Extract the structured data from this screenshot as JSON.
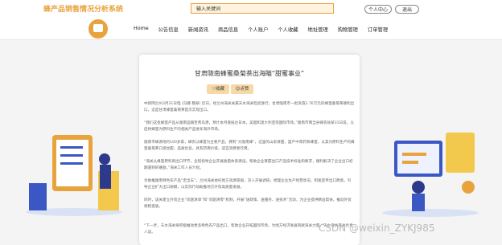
{
  "header": {
    "brand": "蜂产品销售情况分析系统",
    "search_value": "输入关键词",
    "personal_center": "个人中心",
    "logout": "退出"
  },
  "nav": {
    "items": [
      "Home",
      "公告信息",
      "新闻资讯",
      "商品信息",
      "个人账户",
      "个人收藏",
      "地址管理",
      "购物管理",
      "订单管理"
    ]
  },
  "article": {
    "title": "甘肃陇南蜂蜜桑菊茶出海瞄“甜蜜事业”",
    "collect": "收藏",
    "like": "点赞",
    "paragraphs": [
      "中新网兰州3月31日电 (冯娜 魏翠) 近日，经兰州海关关属天水海关检验放行，甘肃陇南市一批货值2.76万元的蜂蜜桑菊茶顺利出口，这是甘肃蜂蜜桑菊茶首次实现出口。",
      "“我们这批蜂蜜产品从陇南运输至青岛港，预计本月底抵达日本，美国和澳大利亚等国际市场。”陇南市两当县蜂农徐某31日说，以后将蜂蜜为原料生产的相关产品进军海外市场。",
      "陇南市蜂源地约100多家，蜂农以蜂蜜为主要产品，拥有“大陇南蜂”，这里的山泉清甜，盛产中草药和蜂蜜，以其为原料生产的蜂蜜桑菊茶口感甘甜，品质优良，具有药用价值，适宜消费者饮用。",
      "“海关从蜂蜜原料到出口环节，全程指导企业开展质量体系建设，帮助企业掌握出口产品技术标准和要求，顺利解决了企业出口初期遇到的难题。”海关工作人员介绍。",
      "为助推陇南特色农产品“走出去”，兰州海关依托地方资源禀赋，深入开展调研，梳理企业生产经营状况，积极宣传出口政策，引导企业扩大出口规模，以实际行动助推地方外贸高质量发展。",
      "同时，该关建立外贸企业“问题清单”和“问题清零”机制，开展“送政策、送服务、送技术”活动，为企业提供精准帮扶，推动外贸保稳提质。",
      "“下一步，天水海关将积极推动更多特色农产品出口，帮助企业开拓国际市场，为地方经济发展贡献海关力量。”天水海关有关负责人说。"
    ]
  },
  "colors": {
    "accent": "#e8a33d",
    "button_bg": "#f7d9a8"
  },
  "watermark": "CSDN @weixin_ZYKJ985"
}
